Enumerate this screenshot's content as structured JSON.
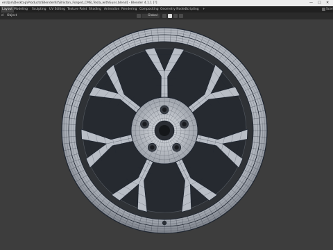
{
  "titlebar": {
    "title": "ers\\Jan\\Desktop\\Products\\BlenderKit\\Brixton_Forged_CM8_Tesla_withGuns.blend] - Blender 4.1.1 [?]",
    "minimize": "—",
    "maximize": "□",
    "close": "✕"
  },
  "menu": {
    "tabs": [
      "Layout",
      "Modeling",
      "Sculpting",
      "UV Editing",
      "Texture Paint",
      "Shading",
      "Animation",
      "Rendering",
      "Compositing",
      "Geometry Nodes",
      "Scripting",
      "+"
    ],
    "active_tab": "Layout",
    "scene_label": "Scene"
  },
  "toolbar": {
    "left_items": [
      "d",
      "Object"
    ],
    "orientation": "Global"
  },
  "colors": {
    "viewport_bg": "#3d3d3d",
    "wire": "#1e2530",
    "metal_light": "#d4d8df",
    "metal_dark": "#8a909a"
  }
}
